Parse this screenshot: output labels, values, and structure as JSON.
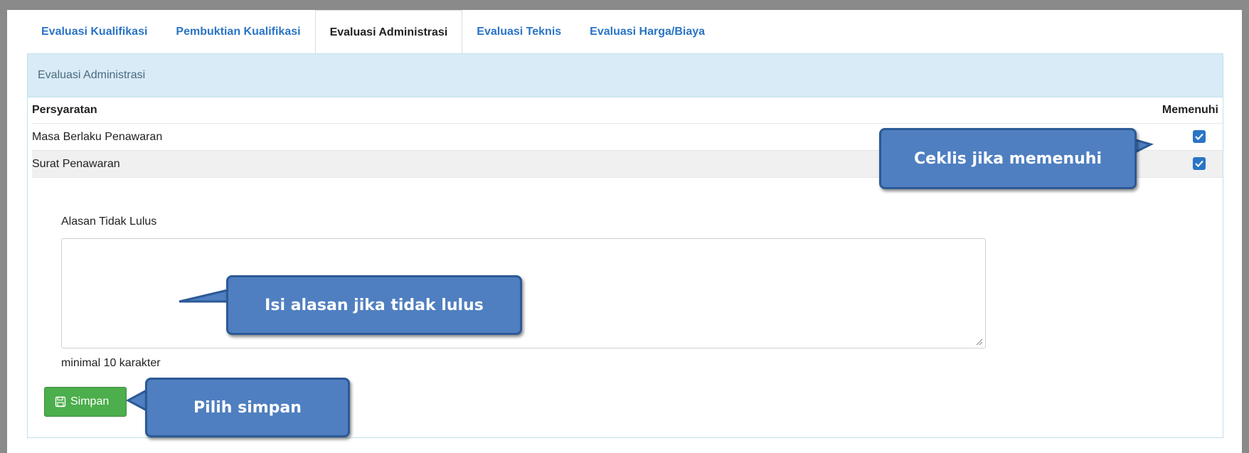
{
  "tabs": [
    {
      "label": "Evaluasi Kualifikasi"
    },
    {
      "label": "Pembuktian Kualifikasi"
    },
    {
      "label": "Evaluasi Administrasi"
    },
    {
      "label": "Evaluasi Teknis"
    },
    {
      "label": "Evaluasi Harga/Biaya"
    }
  ],
  "panel": {
    "heading": "Evaluasi Administrasi"
  },
  "table": {
    "headers": {
      "requirement": "Persyaratan",
      "meets": "Memenuhi"
    },
    "rows": [
      {
        "requirement": "Masa Berlaku Penawaran",
        "checked": true
      },
      {
        "requirement": "Surat Penawaran",
        "checked": true
      }
    ]
  },
  "form": {
    "reason_label": "Alasan Tidak Lulus",
    "reason_value": "",
    "hint": "minimal 10 karakter",
    "save_label": "Simpan",
    "save_icon": "floppy-disk-icon"
  },
  "callouts": {
    "check": "Ceklis jika memenuhi",
    "reason": "Isi alasan jika tidak lulus",
    "save": "Pilih simpan"
  },
  "colors": {
    "accent": "#2a74c5",
    "heading_bg": "#d9ebf6",
    "button_green": "#4cae4c",
    "callout_fill": "#4f7fc0"
  }
}
